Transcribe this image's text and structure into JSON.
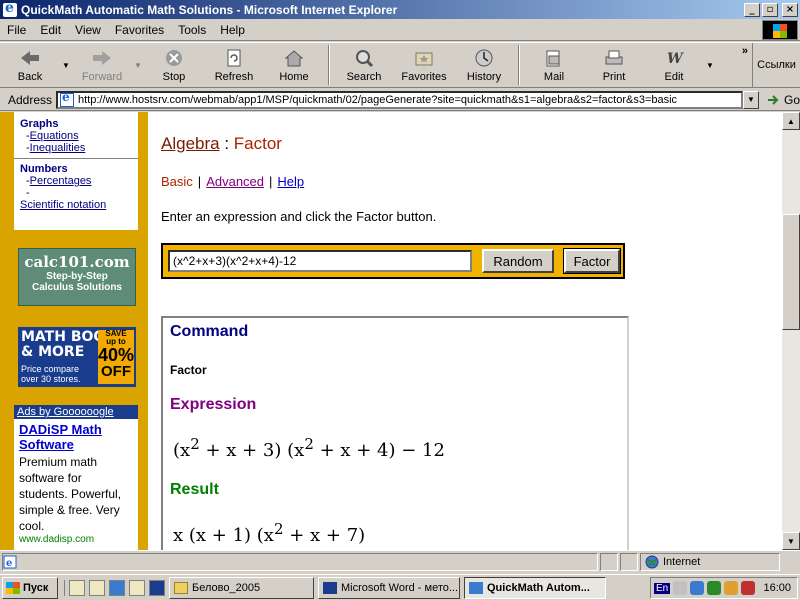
{
  "window": {
    "title": "QuickMath Automatic Math Solutions - Microsoft Internet Explorer",
    "minimize": "_",
    "maximize": "▫",
    "close": "×"
  },
  "menu": [
    "File",
    "Edit",
    "View",
    "Favorites",
    "Tools",
    "Help"
  ],
  "toolbar": {
    "back": "Back",
    "forward": "Forward",
    "stop": "Stop",
    "refresh": "Refresh",
    "home": "Home",
    "search": "Search",
    "favorites": "Favorites",
    "history": "History",
    "mail": "Mail",
    "print": "Print",
    "edit": "Edit",
    "more": "»",
    "links": "Ссылки"
  },
  "address": {
    "label": "Address",
    "url": "http://www.hostsrv.com/webmab/app1/MSP/quickmath/02/pageGenerate?site=quickmath&s1=algebra&s2=factor&s3=basic",
    "go": "Go"
  },
  "sidebar": {
    "graphs_head": "Graphs",
    "graphs_items": [
      "Equations",
      "Inequalities"
    ],
    "numbers_head": "Numbers",
    "numbers_items": [
      "Percentages"
    ],
    "scientific": "Scientific notation",
    "calc_ad": {
      "title": "calc101.com",
      "line1": "Step-by-Step",
      "line2": "Calculus Solutions"
    },
    "books_ad": {
      "line1": "MATH BOOKS",
      "line2": "& MORE",
      "line3": "Price compare",
      "line4": "over 30 stores.",
      "save": "SAVE",
      "upto": "up to",
      "percent": "40%",
      "off": "OFF"
    },
    "google_ad": {
      "header": "Ads by Goooooogle",
      "title": "DADiSP Math Software",
      "desc": "Premium math software for students. Powerful, simple & free. Very cool.",
      "url": "www.dadisp.com"
    }
  },
  "main": {
    "crumb_parent": "Algebra",
    "crumb_sep": " : ",
    "crumb_current": "Factor",
    "tabs": {
      "basic": "Basic",
      "advanced": "Advanced",
      "help": "Help",
      "pipe": "|"
    },
    "instruction": "Enter an expression and click the Factor button.",
    "expression_value": "(x^2+x+3)(x^2+x+4)-12",
    "random_label": "Random",
    "factor_label": "Factor",
    "command_head": "Command",
    "command_value": "Factor",
    "expression_head": "Expression",
    "result_head": "Result"
  },
  "status": {
    "zone": "Internet"
  },
  "taskbar": {
    "start": "Пуск",
    "tasks": [
      "Белово_2005",
      "Microsoft Word - мето...",
      "QuickMath Autom..."
    ],
    "lang": "En",
    "clock": "16:00"
  }
}
